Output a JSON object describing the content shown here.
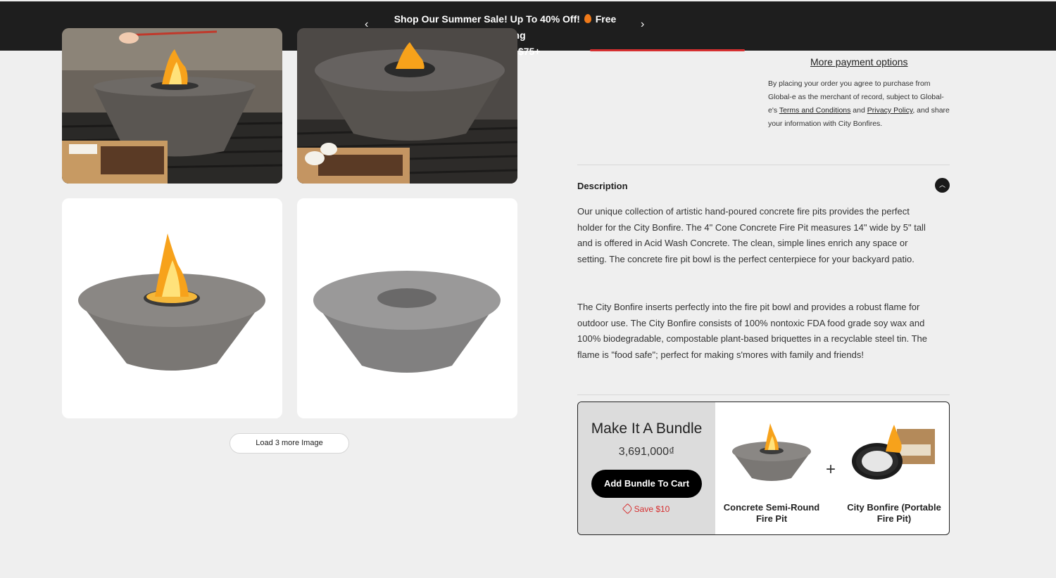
{
  "announcement": {
    "line1_before": "Shop Our Summer Sale! Up To 40% Off!",
    "line1_after": "Free shipping",
    "line2": "on orders $75+",
    "prev_icon": "chevron-left-icon",
    "next_icon": "chevron-right-icon"
  },
  "gallery": {
    "load_more_label": "Load 3 more Image"
  },
  "payment": {
    "more_options_label": "More payment options",
    "legal_prefix": "By placing your order you agree to purchase from Global-e as the merchant of record, subject to Global-e's ",
    "terms_link": "Terms and Conditions",
    "legal_and": " and ",
    "privacy_link": "Privacy Policy",
    "legal_suffix": ", and share your information with City Bonfires."
  },
  "description": {
    "title": "Description",
    "toggle_icon": "chevron-up-icon",
    "paragraph1": "Our unique collection of artistic hand-poured concrete fire pits provides the perfect holder for the City Bonfire. The 4\" Cone Concrete Fire Pit measures 14\" wide by 5\" tall and is offered in Acid Wash Concrete. The clean, simple lines enrich any space or setting. The concrete fire pit bowl is the perfect centerpiece for your backyard patio.",
    "paragraph2": "The City Bonfire inserts perfectly into the fire pit bowl and provides a robust flame for outdoor use. The City Bonfire consists of 100% nontoxic FDA food grade soy wax and 100% biodegradable, compostable plant-based briquettes in a recyclable steel tin. The flame is \"food safe\"; perfect for making s'mores with family and friends!"
  },
  "bundle": {
    "title": "Make It A Bundle",
    "price": "3,691,000₫",
    "button_label": "Add Bundle To Cart",
    "save_label": "Save $10",
    "plus_sign": "+",
    "products": [
      {
        "name": "Concrete Semi-Round Fire Pit"
      },
      {
        "name": "City Bonfire (Portable Fire Pit)"
      }
    ]
  },
  "colors": {
    "announcement_bg": "#1e1e1e",
    "accent_red": "#d63031",
    "page_bg": "#efefef"
  }
}
